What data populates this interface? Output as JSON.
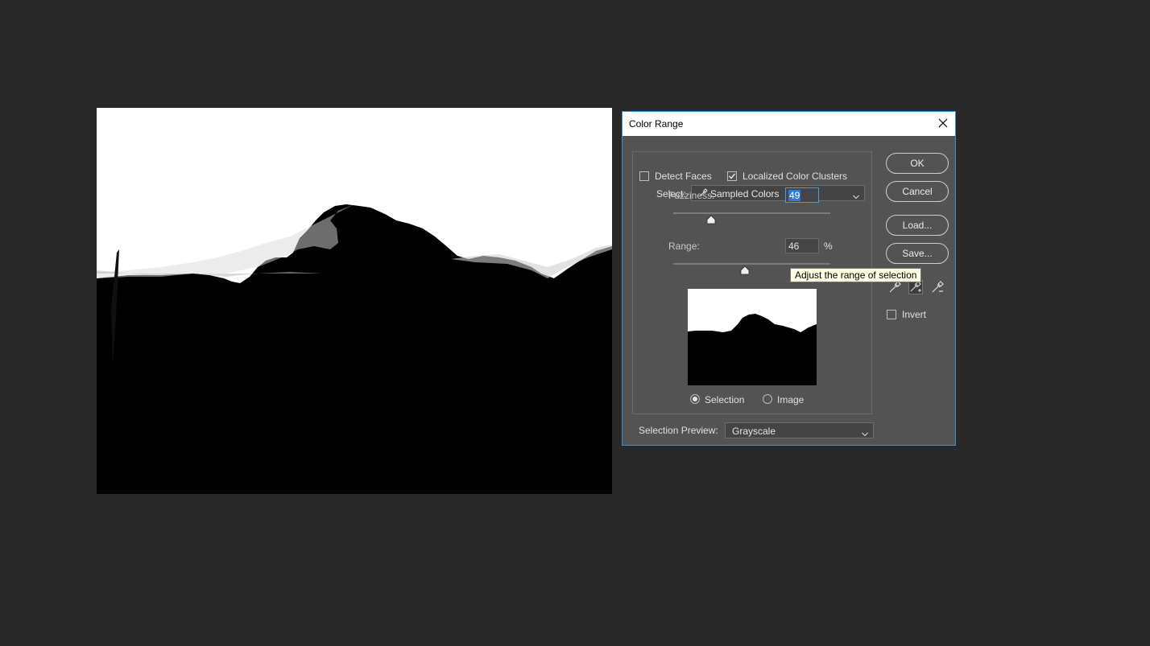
{
  "dialog": {
    "title": "Color Range",
    "select_label": "Select:",
    "select_value": "Sampled Colors",
    "detect_faces": {
      "label": "Detect Faces",
      "checked": false
    },
    "localized_clusters": {
      "label": "Localized Color Clusters",
      "checked": true
    },
    "fuzziness": {
      "label": "Fuzziness:",
      "value": "49"
    },
    "range": {
      "label": "Range:",
      "value": "46",
      "unit": "%"
    },
    "preview_mode": {
      "selection_label": "Selection",
      "image_label": "Image",
      "selected": "Selection"
    },
    "selection_preview_label": "Selection Preview:",
    "selection_preview_value": "Grayscale",
    "buttons": {
      "ok": "OK",
      "cancel": "Cancel",
      "load": "Load...",
      "save": "Save..."
    },
    "invert": {
      "label": "Invert",
      "checked": false
    },
    "tools": [
      "eyedropper-icon",
      "eyedropper-plus-icon",
      "eyedropper-minus-icon"
    ]
  },
  "tooltip": {
    "text": "Adjust the range of selection"
  },
  "colors": {
    "workspace": "#282828",
    "dialog_bg": "#535353",
    "dialog_border": "#3e8ed0",
    "highlight": "#2e7bd6",
    "tooltip_bg": "#ffffe1"
  }
}
